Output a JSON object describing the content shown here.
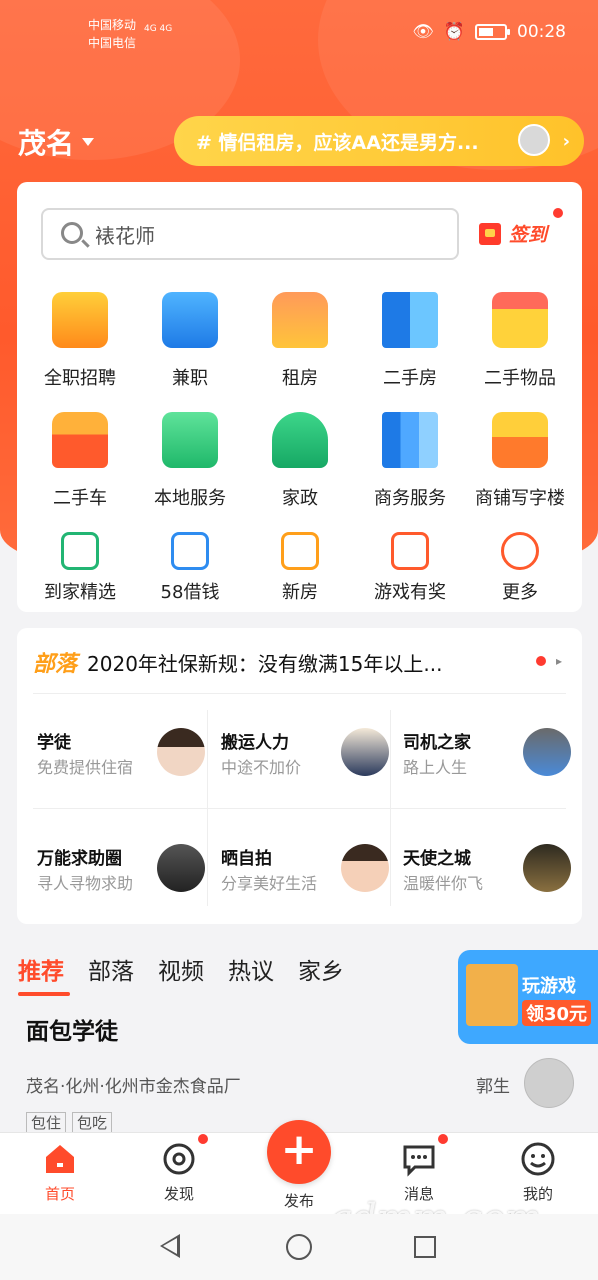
{
  "status_bar": {
    "carrier1": "中国移动",
    "carrier2": "中国电信",
    "signal": "4G  4G",
    "time": "00:28"
  },
  "header": {
    "city": "茂名",
    "topic": "# 情侣租房，应该AA还是男方..."
  },
  "search": {
    "placeholder": "裱花师"
  },
  "signin": {
    "label": "签到"
  },
  "categories": [
    {
      "label": "全职招聘",
      "icon": "briefcase-icon",
      "color": "#ff9f1a"
    },
    {
      "label": "兼职",
      "icon": "clock-icon",
      "color": "#2e8cf0"
    },
    {
      "label": "租房",
      "icon": "sofa-icon",
      "color": "#ff7a30"
    },
    {
      "label": "二手房",
      "icon": "building-icon",
      "color": "#2e9cf0"
    },
    {
      "label": "二手物品",
      "icon": "gift-box-icon",
      "color": "#ffc21a"
    },
    {
      "label": "二手车",
      "icon": "car-icon",
      "color": "#ff5a2c"
    },
    {
      "label": "本地服务",
      "icon": "map-pin-icon",
      "color": "#2ecc71"
    },
    {
      "label": "家政",
      "icon": "house-sprout-icon",
      "color": "#22b573"
    },
    {
      "label": "商务服务",
      "icon": "chart-upload-icon",
      "color": "#2e8cf0"
    },
    {
      "label": "商铺写字楼",
      "icon": "shop-icon",
      "color": "#ff8a2c"
    }
  ],
  "small_links": [
    {
      "label": "到家精选",
      "icon": "home-d-icon",
      "color": "#22b573"
    },
    {
      "label": "58借钱",
      "icon": "yen-card-icon",
      "color": "#2e8cf0"
    },
    {
      "label": "新房",
      "icon": "heart-house-icon",
      "color": "#ff9f1a"
    },
    {
      "label": "游戏有奖",
      "icon": "yen-house-icon",
      "color": "#ff5a2c"
    },
    {
      "label": "更多",
      "icon": "menu-circle-icon",
      "color": "#ff5a2c"
    }
  ],
  "tribe": {
    "logo": "部落",
    "headline": "2020年社保新规：没有缴满15年以上...",
    "cells": [
      {
        "title": "学徒",
        "subtitle": "免费提供住宿"
      },
      {
        "title": "搬运人力",
        "subtitle": "中途不加价"
      },
      {
        "title": "司机之家",
        "subtitle": "路上人生"
      },
      {
        "title": "万能求助圈",
        "subtitle": "寻人寻物求助"
      },
      {
        "title": "晒自拍",
        "subtitle": "分享美好生活"
      },
      {
        "title": "天使之城",
        "subtitle": "温暖伴你飞"
      }
    ]
  },
  "feed_tabs": [
    "推荐",
    "部落",
    "视频",
    "热议",
    "家乡"
  ],
  "promo": {
    "line1": "玩游戏",
    "line2": "领30元"
  },
  "job": {
    "title": "面包学徒",
    "location": "茂名·化州·化州市金杰食品厂",
    "owner": "郭生",
    "tags": [
      "包住",
      "包吃"
    ]
  },
  "bottom_nav": [
    {
      "label": "首页"
    },
    {
      "label": "发现"
    },
    {
      "label": "发布"
    },
    {
      "label": "消息"
    },
    {
      "label": "我的"
    }
  ],
  "watermark": "gdmm.com",
  "colors": {
    "brand": "#ff5a2c",
    "accent_yellow": "#ffc22a",
    "badge": "#ff3b30"
  }
}
